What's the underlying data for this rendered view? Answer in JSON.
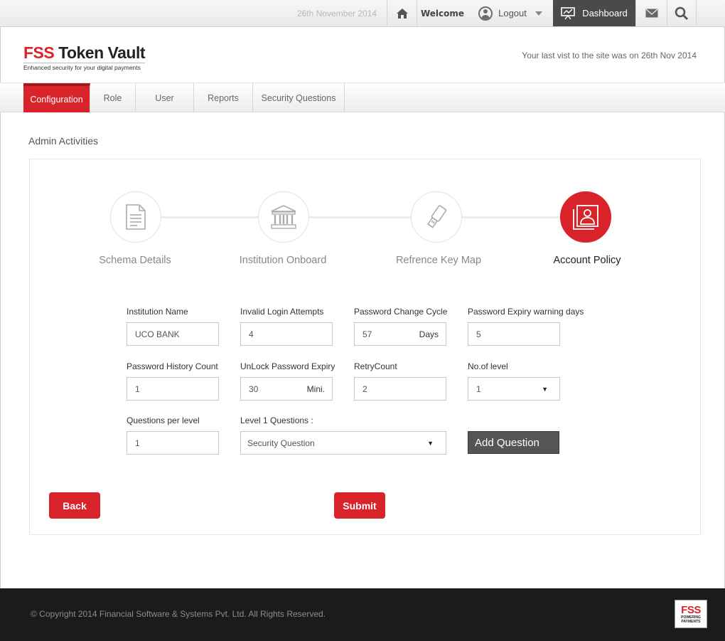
{
  "topbar": {
    "date": "26th November 2014",
    "welcome": "Welcome",
    "logout": "Logout",
    "dashboard": "Dashboard"
  },
  "header": {
    "logo_prefix": "FSS",
    "logo_name": "Token Vault",
    "tagline": "Enhanced security for your digital payments",
    "last_visit": "Your last vist to the site was on 26th Nov 2014"
  },
  "nav": {
    "items": [
      {
        "label": "Configuration",
        "active": true
      },
      {
        "label": "Role"
      },
      {
        "label": "User"
      },
      {
        "label": "Reports"
      },
      {
        "label": "Security Questions"
      }
    ]
  },
  "page": {
    "section_title": "Admin Activities"
  },
  "steps": [
    {
      "label": "Schema Details",
      "icon": "document-icon"
    },
    {
      "label": "Institution Onboard",
      "icon": "bank-icon"
    },
    {
      "label": "Refrence Key Map",
      "icon": "usb-key-icon"
    },
    {
      "label": "Account Policy",
      "icon": "profile-picture-icon",
      "active": true
    }
  ],
  "form": {
    "institution_name": {
      "label": "Institution Name",
      "value": "UCO BANK"
    },
    "invalid_login_attempts": {
      "label": "Invalid Login Attempts",
      "value": "4"
    },
    "password_change_cycle": {
      "label": "Password Change Cycle",
      "value": "57",
      "suffix": "Days"
    },
    "password_expiry_warning": {
      "label": "Password Expiry warning days",
      "value": "5"
    },
    "password_history_count": {
      "label": "Password History Count",
      "value": "1"
    },
    "unlock_password_expiry": {
      "label": "UnLock Password Expiry",
      "value": "30",
      "suffix": "Mini."
    },
    "retry_count": {
      "label": "RetryCount",
      "value": "2"
    },
    "no_of_level": {
      "label": "No.of level",
      "value": "1"
    },
    "questions_per_level": {
      "label": "Questions per level",
      "value": "1"
    },
    "level1_questions": {
      "label": "Level 1 Questions :",
      "value": "Security Question"
    },
    "add_question": "Add Question",
    "back": "Back",
    "submit": "Submit"
  },
  "footer": {
    "copyright": "© Copyright 2014 Financial Software & Systems Pvt. Ltd. All Rights Reserved.",
    "logo_big": "FSS",
    "logo_small_1": "POWERING",
    "logo_small_2": "PAYMENTS"
  },
  "colors": {
    "brand_red": "#d9232a",
    "dashboard_bg": "#4a4a4a",
    "footer_bg": "#1b1b1b"
  }
}
